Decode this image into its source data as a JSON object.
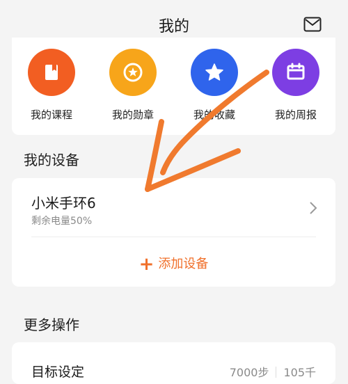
{
  "header": {
    "title": "我的",
    "mail_icon": "mail-icon"
  },
  "shortcuts": [
    {
      "label": "我的课程",
      "color": "#f25e22",
      "icon": "book-icon"
    },
    {
      "label": "我的勋章",
      "color": "#f7a51a",
      "icon": "medal-icon"
    },
    {
      "label": "我的收藏",
      "color": "#2f64ec",
      "icon": "star-icon"
    },
    {
      "label": "我的周报",
      "color": "#7d3ee3",
      "icon": "report-icon"
    }
  ],
  "devices_section": {
    "title": "我的设备",
    "device": {
      "name": "小米手环6",
      "status": "剩余电量50%"
    },
    "add_label": "添加设备"
  },
  "more_section": {
    "title": "更多操作",
    "goal": {
      "label": "目标设定",
      "steps": "7000步",
      "calories": "105千"
    }
  },
  "accent_color": "#f0702b",
  "annotation_color": "#f07a2e"
}
